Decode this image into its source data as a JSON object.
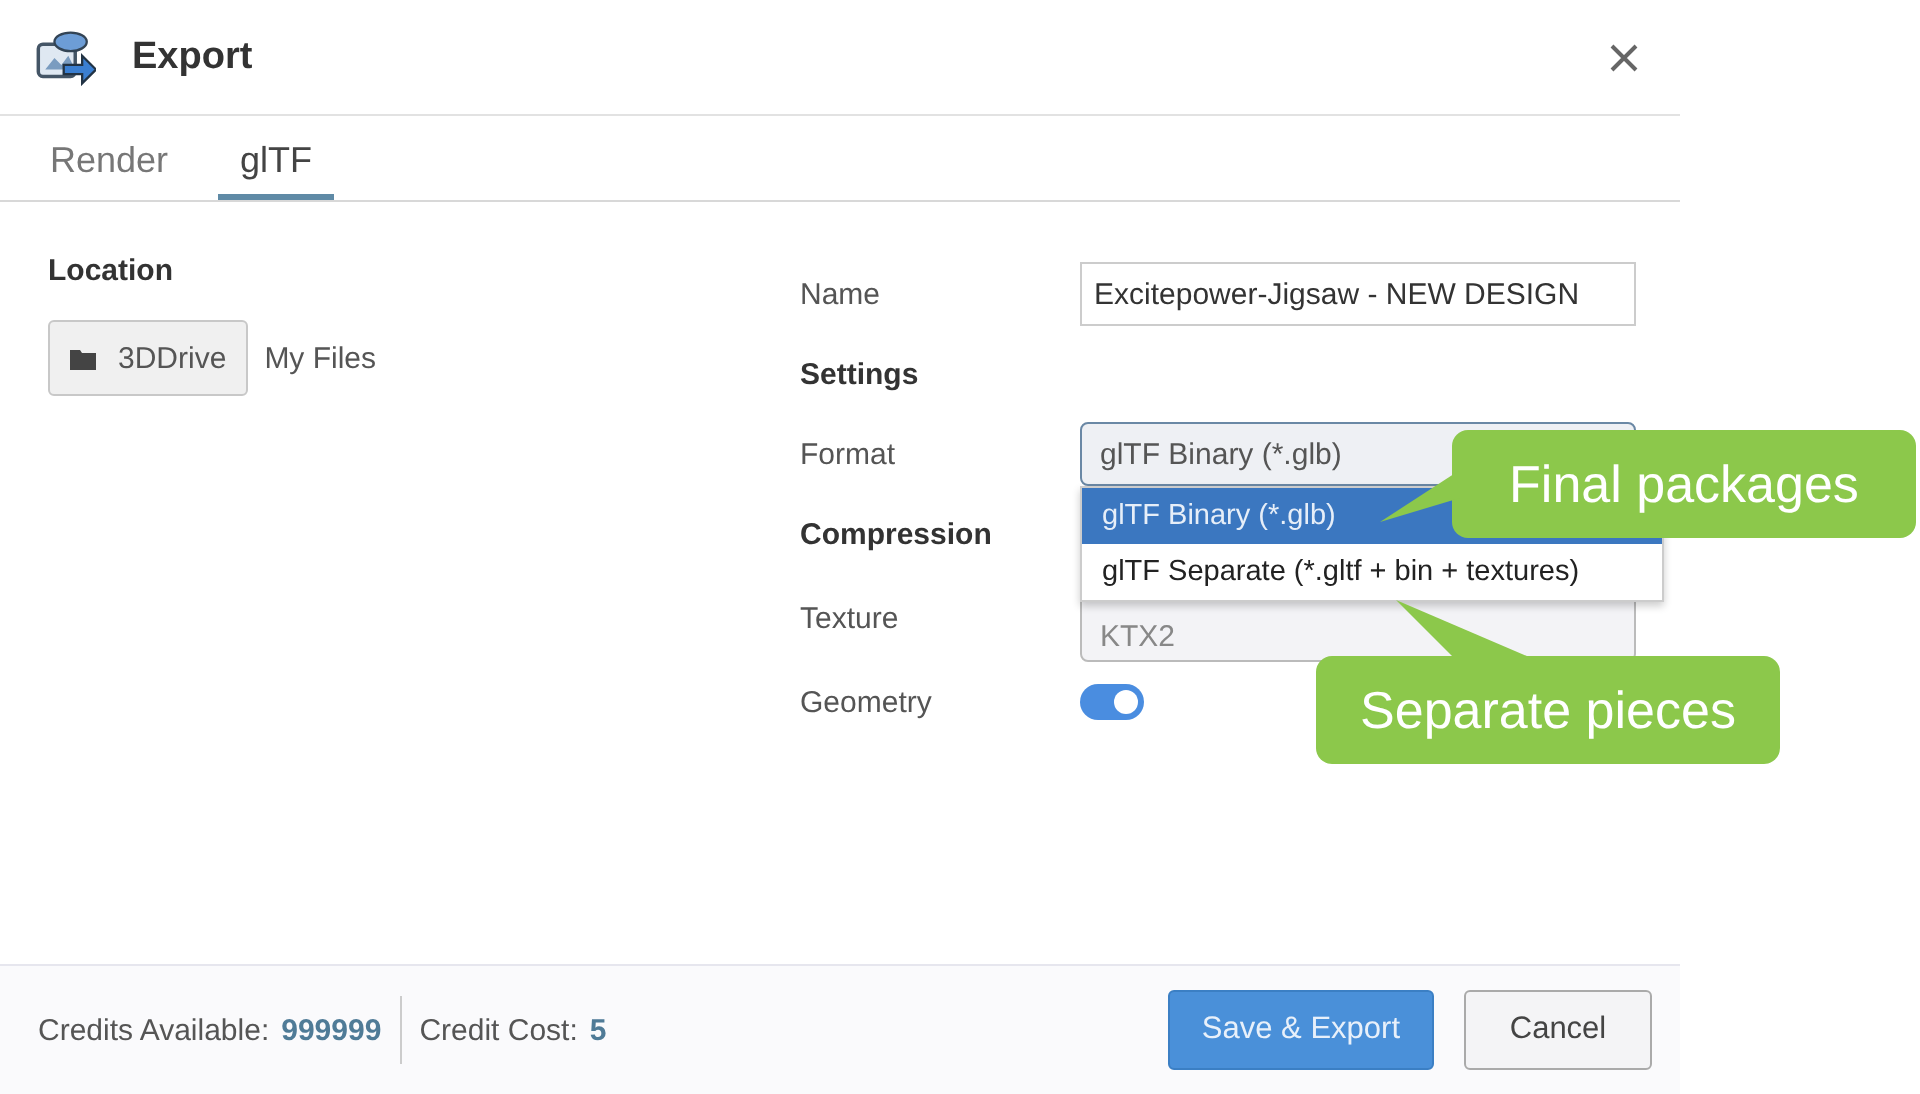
{
  "window": {
    "title": "Export"
  },
  "tabs": [
    {
      "label": "Render",
      "selected": false
    },
    {
      "label": "glTF",
      "selected": true
    }
  ],
  "location": {
    "heading": "Location",
    "button": "3DDrive",
    "path": "My Files"
  },
  "name": {
    "label": "Name",
    "value": "Excitepower-Jigsaw - NEW DESIGN"
  },
  "settings": {
    "heading": "Settings",
    "format_label": "Format",
    "format_value": "glTF Binary (*.glb)",
    "format_options": [
      {
        "label": "glTF Binary (*.glb)",
        "selected": true
      },
      {
        "label": "glTF Separate (*.gltf + bin + textures)",
        "selected": false
      }
    ]
  },
  "compression": {
    "heading": "Compression",
    "texture_label": "Texture",
    "texture_value": "KTX2",
    "geometry_label": "Geometry",
    "geometry_on": true
  },
  "callouts": [
    "Final packages",
    "Separate pieces"
  ],
  "footer": {
    "credits_label": "Credits Available:",
    "credits_value": "999999",
    "cost_label": "Credit Cost:",
    "cost_value": "5"
  },
  "buttons": [
    {
      "label": "Save & Export",
      "kind": "primary"
    },
    {
      "label": "Cancel",
      "kind": "secondary"
    }
  ]
}
